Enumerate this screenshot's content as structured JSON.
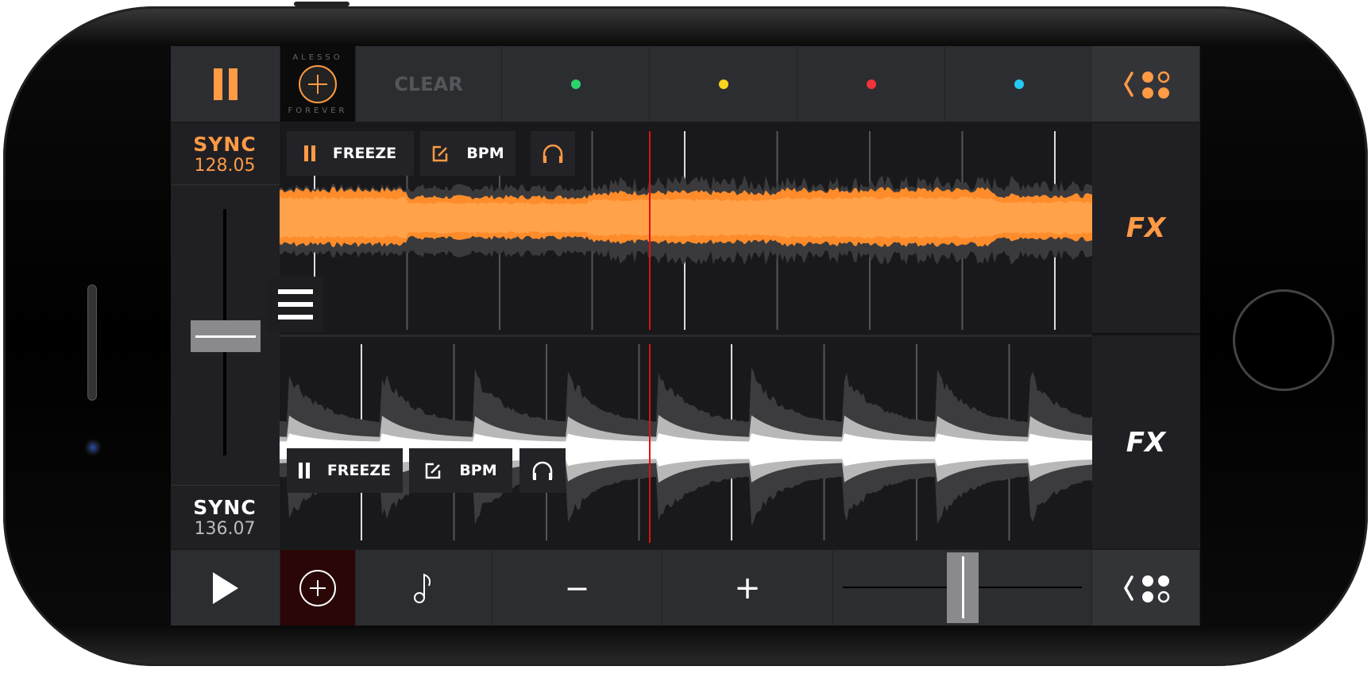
{
  "top_bar": {
    "clear_label": "CLEAR",
    "album_text_top": "ALESSO",
    "album_text_bottom": "FOREVER",
    "cue_colors": [
      "#2bd36b",
      "#f7d51e",
      "#f2323a",
      "#25c9f5"
    ]
  },
  "deck1": {
    "sync_label": "SYNC",
    "bpm": "128.05",
    "freeze_label": "FREEZE",
    "bpm_label": "BPM",
    "fx_label": "FX",
    "color": "#ff9a45"
  },
  "deck2": {
    "sync_label": "SYNC",
    "bpm": "136.07",
    "freeze_label": "FREEZE",
    "bpm_label": "BPM",
    "fx_label": "FX",
    "color": "#ffffff"
  },
  "bottom_bar": {
    "minus_label": "−",
    "plus_label": "+"
  },
  "crossfader_position": 0.5
}
